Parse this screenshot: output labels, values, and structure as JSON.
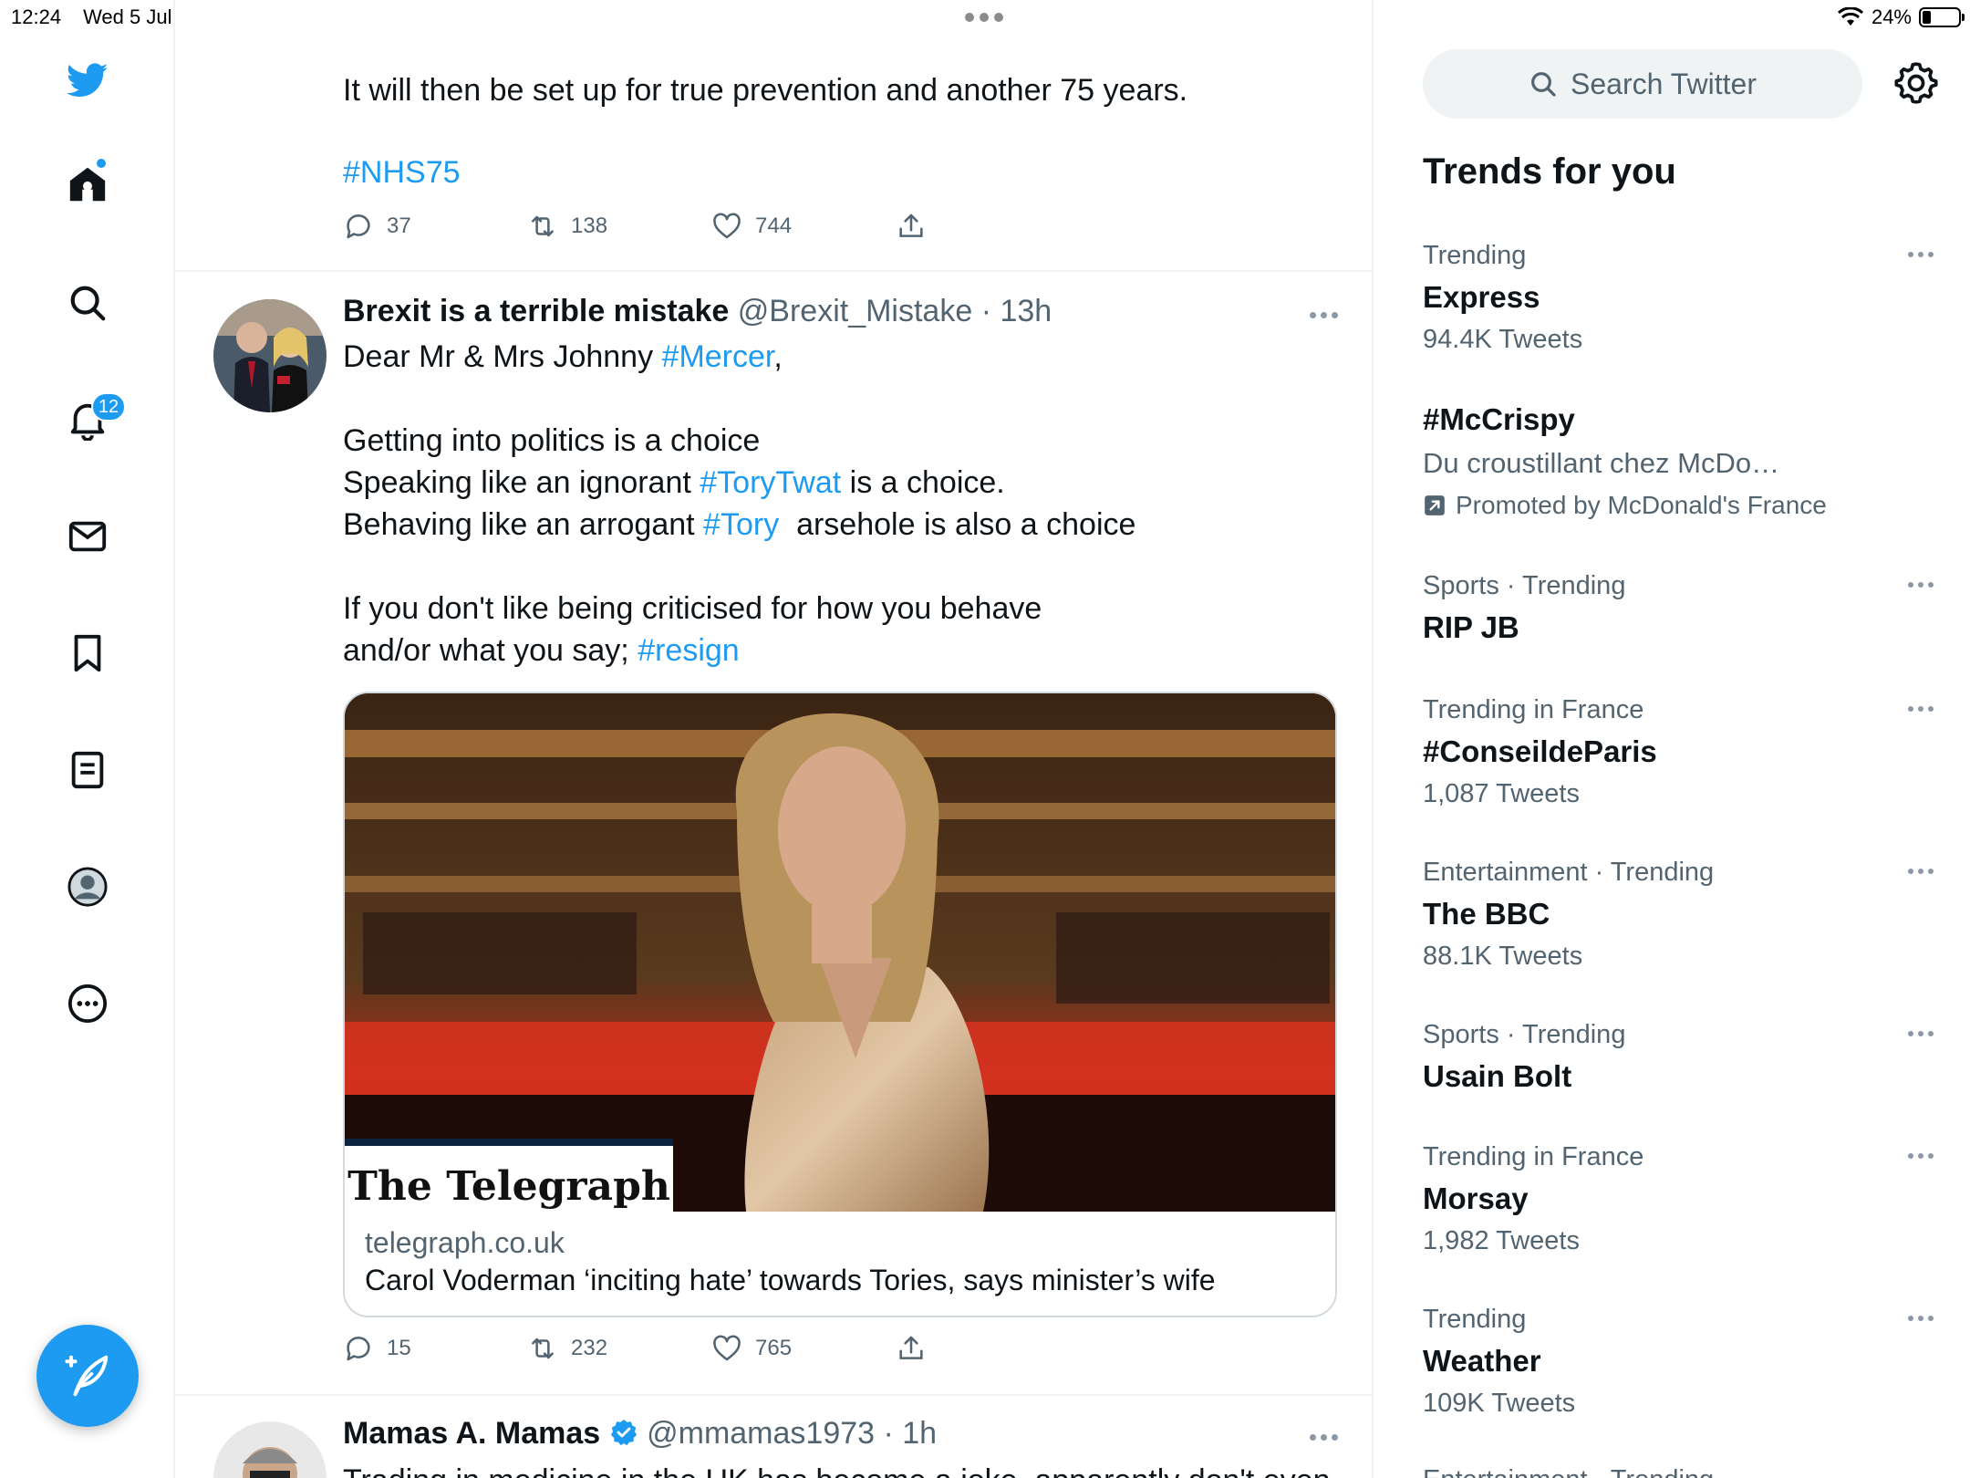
{
  "status_bar": {
    "time": "12:24",
    "date": "Wed 5 Jul",
    "battery_percent": "24%",
    "battery_level": 0.24
  },
  "nav": {
    "items": [
      {
        "name": "twitter-logo-icon"
      },
      {
        "name": "home-icon"
      },
      {
        "name": "explore-search-icon"
      },
      {
        "name": "notifications-bell-icon"
      },
      {
        "name": "messages-mail-icon"
      },
      {
        "name": "bookmarks-icon"
      },
      {
        "name": "lists-icon"
      },
      {
        "name": "profile-icon"
      },
      {
        "name": "more-options-icon"
      }
    ],
    "notification_count": "12",
    "compose_icon": "compose-feather-icon"
  },
  "feed": {
    "tweet1": {
      "text_line": "It will then be set up for true prevention and another 75 years.",
      "hashtag": "#NHS75",
      "replies": "37",
      "retweets": "138",
      "likes": "744"
    },
    "tweet2": {
      "name": "Brexit is a terrible mistake",
      "handle": "@Brexit_Mistake",
      "time": "· 13h",
      "line1_a": "Dear Mr & Mrs Johnny ",
      "line1_tag": "#Mercer",
      "line1_b": ",",
      "line2": "Getting into politics is a choice",
      "line3_a": "Speaking like an ignorant ",
      "line3_tag": "#ToryTwat",
      "line3_b": " is a choice.",
      "line4_a": "Behaving like an arrogant ",
      "line4_tag": "#Tory",
      "line4_b": "  arsehole is also a choice",
      "line5": "If you don't like being criticised for how you behave",
      "line6_a": "and/or what you say; ",
      "line6_tag": "#resign",
      "card": {
        "logo": "The Telegraph",
        "domain": "telegraph.co.uk",
        "title": "Carol Voderman ‘inciting hate’ towards Tories, says minister’s wife"
      },
      "replies": "15",
      "retweets": "232",
      "likes": "765"
    },
    "tweet3": {
      "name": "Mamas A. Mamas",
      "handle": "@mmamas1973",
      "time": "· 1h",
      "text_partial": "Trading in medicine in the UK has become a joke, apparently don't even"
    }
  },
  "sidebar": {
    "search_placeholder": "Search Twitter",
    "trends_title": "Trends for you",
    "trends": [
      {
        "context": "Trending",
        "name": "Express",
        "count": "94.4K Tweets"
      },
      {
        "name": "#McCrispy",
        "description": "Du croustillant chez McDo…",
        "promoted": "Promoted by McDonald's France"
      },
      {
        "context": "Sports · Trending",
        "name": "RIP JB"
      },
      {
        "context": "Trending in France",
        "name": "#ConseildeParis",
        "count": "1,087 Tweets"
      },
      {
        "context": "Entertainment · Trending",
        "name": "The BBC",
        "count": "88.1K Tweets"
      },
      {
        "context": "Sports · Trending",
        "name": "Usain Bolt"
      },
      {
        "context": "Trending in France",
        "name": "Morsay",
        "count": "1,982 Tweets"
      },
      {
        "context": "Trending",
        "name": "Weather",
        "count": "109K Tweets"
      },
      {
        "context": "Entertainment · Trending"
      }
    ]
  },
  "colors": {
    "accent": "#1d9bf0",
    "text_primary": "#0f1419",
    "text_secondary": "#536471",
    "border": "#eff3f4"
  }
}
